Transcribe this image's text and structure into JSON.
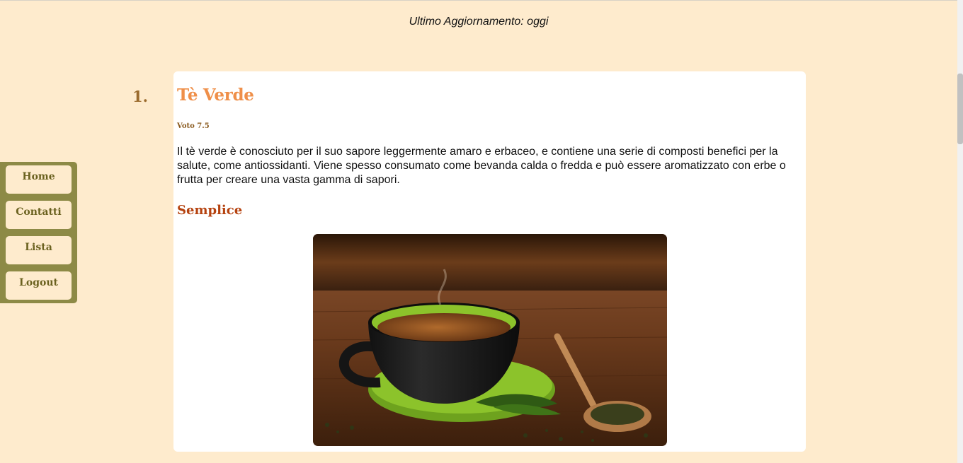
{
  "header": {
    "last_updated": "Ultimo Aggiornamento: oggi"
  },
  "sidebar": {
    "items": [
      {
        "label": "Home"
      },
      {
        "label": "Contatti"
      },
      {
        "label": "Lista"
      },
      {
        "label": "Logout"
      }
    ]
  },
  "item": {
    "number": "1.",
    "title": "Tè Verde",
    "rating": "Voto 7.5",
    "description": "Il tè verde è conosciuto per il suo sapore leggermente amaro e erbaceo, e contiene una serie di composti benefici per la salute, come antiossidanti. Viene spesso consumato come bevanda calda o fredda e può essere aromatizzato con erbe o frutta per creare una vasta gamma di sapori.",
    "difficulty": "Semplice",
    "image_icon": "green-tea-cup-photo"
  },
  "colors": {
    "background": "#feebcd",
    "sidebar": "#8d8a46",
    "title": "#ef8f49",
    "difficulty": "#b5420f"
  }
}
